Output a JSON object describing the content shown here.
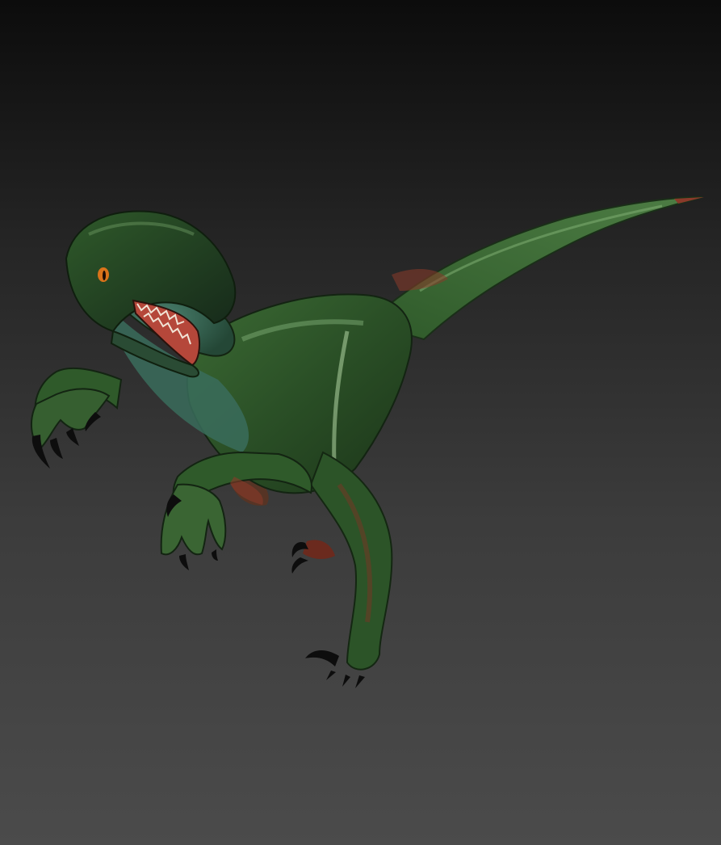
{
  "viewport": {
    "background_top": "#0c0c0c",
    "background_bottom": "#4b4b4b"
  },
  "model": {
    "subject": "velociraptor-3d-model",
    "skin_color": "#2f5a2a",
    "highlight_color": "#7fae73",
    "underside_color": "#3d6e5a",
    "accent_color": "#8a3a2a",
    "claw_color": "#0d0d0d",
    "eye_color": "#d9731a",
    "mouth_color": "#b5473a"
  }
}
